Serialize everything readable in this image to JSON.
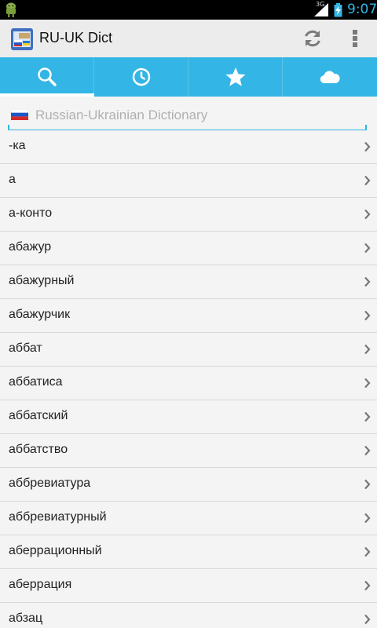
{
  "status_bar": {
    "network": "3G",
    "time": "9:07"
  },
  "action_bar": {
    "title": "RU-UK Dict",
    "icons": {
      "app": "app-icon",
      "refresh": "refresh-icon",
      "overflow": "overflow-menu-icon"
    }
  },
  "tabs": [
    {
      "icon": "search-icon",
      "selected": true
    },
    {
      "icon": "clock-icon",
      "selected": false
    },
    {
      "icon": "star-icon",
      "selected": false
    },
    {
      "icon": "cloud-icon",
      "selected": false
    }
  ],
  "search": {
    "placeholder": "Russian-Ukrainian Dictionary",
    "value": ""
  },
  "words": [
    "-ка",
    "а",
    "а-конто",
    "абажур",
    "абажурный",
    "абажурчик",
    "аббат",
    "аббатиса",
    "аббатский",
    "аббатство",
    "аббревиатура",
    "аббревиатурный",
    "аберрационный",
    "аберрация",
    "абзац"
  ],
  "colors": {
    "accent": "#33b5e5",
    "action_bar": "#ececec",
    "background": "#f4f4f4"
  }
}
